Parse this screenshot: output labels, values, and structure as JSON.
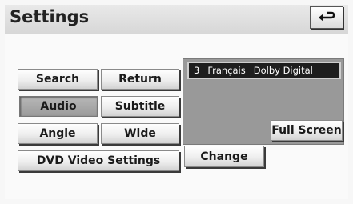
{
  "header": {
    "title": "Settings",
    "back_icon": "return-arrow-icon"
  },
  "buttons": {
    "search": "Search",
    "return": "Return",
    "audio": "Audio",
    "subtitle": "Subtitle",
    "angle": "Angle",
    "wide": "Wide",
    "dvd_video_settings": "DVD Video Settings",
    "change": "Change",
    "full_screen": "Full Screen"
  },
  "video": {
    "audio_track_number": "3",
    "audio_language": "Français",
    "audio_format": "Dolby Digital"
  }
}
